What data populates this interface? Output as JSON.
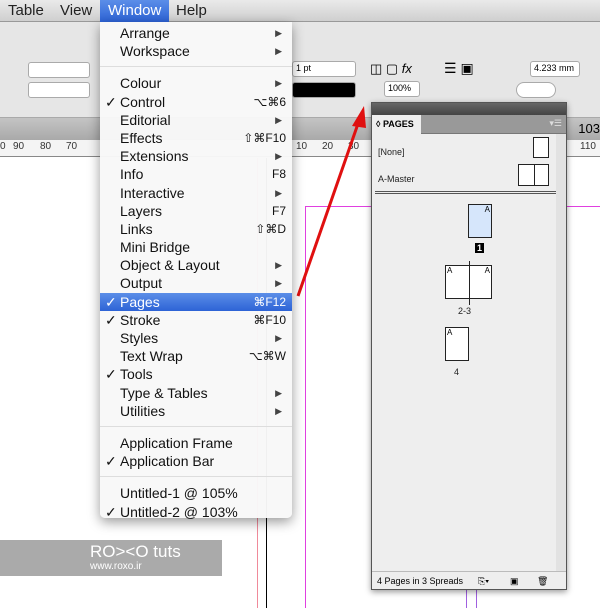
{
  "menubar": {
    "items": [
      "Table",
      "View",
      "Window",
      "Help"
    ],
    "active": "Window"
  },
  "control": {
    "stroke_weight": "1 pt",
    "opacity": "100%",
    "size": "4.233 mm",
    "zoom_readout": "103"
  },
  "ruler": {
    "left": [
      "0",
      "90",
      "80",
      "70"
    ],
    "right": [
      "10",
      "20",
      "30",
      "110"
    ]
  },
  "window_menu": {
    "groups": [
      [
        {
          "label": "Arrange",
          "submenu": true
        },
        {
          "label": "Workspace",
          "submenu": true
        }
      ],
      [
        {
          "label": "Colour",
          "submenu": true
        },
        {
          "label": "Control",
          "checked": true,
          "shortcut": "⌥⌘6"
        },
        {
          "label": "Editorial",
          "submenu": true
        },
        {
          "label": "Effects",
          "shortcut": "⇧⌘F10"
        },
        {
          "label": "Extensions",
          "submenu": true
        },
        {
          "label": "Info",
          "shortcut": "F8"
        },
        {
          "label": "Interactive",
          "submenu": true
        },
        {
          "label": "Layers",
          "shortcut": "F7"
        },
        {
          "label": "Links",
          "shortcut": "⇧⌘D"
        },
        {
          "label": "Mini Bridge"
        },
        {
          "label": "Object & Layout",
          "submenu": true
        },
        {
          "label": "Output",
          "submenu": true
        },
        {
          "label": "Pages",
          "checked": true,
          "shortcut": "⌘F12",
          "highlighted": true
        },
        {
          "label": "Stroke",
          "checked": true,
          "shortcut": "⌘F10"
        },
        {
          "label": "Styles",
          "submenu": true
        },
        {
          "label": "Text Wrap",
          "shortcut": "⌥⌘W"
        },
        {
          "label": "Tools",
          "checked": true
        },
        {
          "label": "Type & Tables",
          "submenu": true
        },
        {
          "label": "Utilities",
          "submenu": true
        }
      ],
      [
        {
          "label": "Application Frame"
        },
        {
          "label": "Application Bar",
          "checked": true
        }
      ],
      [
        {
          "label": "Untitled-1 @ 105%"
        },
        {
          "label": "Untitled-2 @ 103%",
          "checked": true
        }
      ]
    ]
  },
  "pages_panel": {
    "tab": "PAGES",
    "masters": [
      "[None]",
      "A-Master"
    ],
    "page_labels": [
      "1",
      "2-3",
      "4"
    ],
    "master_prefix": "A",
    "footer": "4 Pages in 3 Spreads"
  },
  "watermark": {
    "brand": "RO><O tuts",
    "url": "www.roxo.ir"
  },
  "colors": {
    "highlight": "#3a70dd",
    "arrow": "#e01010",
    "selected_page": "#d6e6fb"
  }
}
